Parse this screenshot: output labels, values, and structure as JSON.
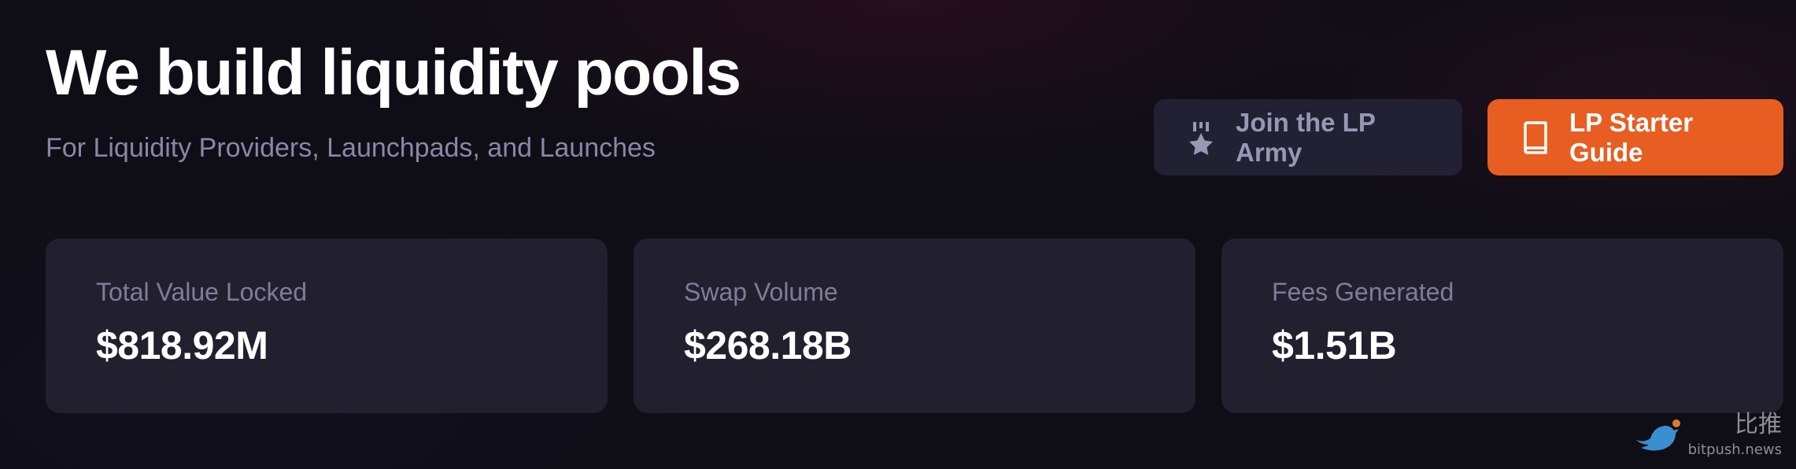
{
  "hero": {
    "title": "We build liquidity pools",
    "subtitle": "For Liquidity Providers, Launchpads, and Launches"
  },
  "actions": {
    "join_label": "Join the LP Army",
    "join_icon": "medal-star-icon",
    "guide_label": "LP Starter Guide",
    "guide_icon": "book-icon"
  },
  "stats": [
    {
      "label": "Total Value Locked",
      "value": "$818.92M"
    },
    {
      "label": "Swap Volume",
      "value": "$268.18B"
    },
    {
      "label": "Fees Generated",
      "value": "$1.51B"
    }
  ],
  "watermark": {
    "chinese": "比推",
    "domain": "bitpush.news",
    "logo": "bird-logo"
  },
  "colors": {
    "background": "#0f0d16",
    "card": "#22202f",
    "accent": "#e85d22",
    "muted_text": "#8a87a6"
  }
}
